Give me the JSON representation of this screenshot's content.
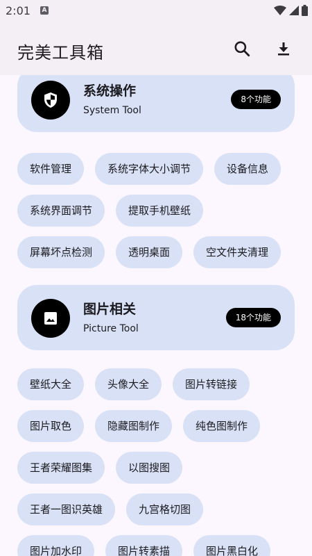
{
  "status_bar": {
    "time": "2:01",
    "notif_letter": "A"
  },
  "app_bar": {
    "title": "完美工具箱",
    "search_icon": "search-icon",
    "download_icon": "download-icon"
  },
  "sections": [
    {
      "title": "系统操作",
      "subtitle": "System Tool",
      "badge": "8个功能",
      "icon": "shield-icon",
      "rows": [
        [
          "软件管理",
          "系统字体大小调节",
          "设备信息"
        ],
        [
          "系统界面调节",
          "提取手机壁纸"
        ],
        [
          "屏幕坏点检测",
          "透明桌面",
          "空文件夹清理"
        ]
      ]
    },
    {
      "title": "图片相关",
      "subtitle": "Picture Tool",
      "badge": "18个功能",
      "icon": "image-icon",
      "rows": [
        [
          "壁纸大全",
          "头像大全",
          "图片转链接"
        ],
        [
          "图片取色",
          "隐藏图制作",
          "纯色图制作"
        ],
        [
          "王者荣耀图集",
          "以图搜图"
        ],
        [
          "王者一图识英雄",
          "九宫格切图"
        ],
        [
          "图片加水印",
          "图片转素描",
          "图片黑白化"
        ]
      ]
    }
  ]
}
